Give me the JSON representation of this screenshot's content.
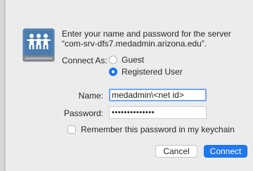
{
  "dialog": {
    "message": "Enter your name and password for the server “com-srv-dfs7.medadmin.arizona.edu”.",
    "icon": "network-server-users-icon"
  },
  "connect_as": {
    "label": "Connect As:",
    "options": [
      {
        "label": "Guest",
        "selected": false
      },
      {
        "label": "Registered User",
        "selected": true
      }
    ]
  },
  "fields": {
    "name_label": "Name:",
    "name_value": "medadmin\\<net id>",
    "password_label": "Password:",
    "password_value": "••••••••••••••"
  },
  "remember": {
    "label": "Remember this password in my keychain",
    "checked": false
  },
  "buttons": {
    "cancel": "Cancel",
    "connect": "Connect"
  },
  "colors": {
    "accent": "#1f78f0",
    "focus_ring": "#73a6f0"
  }
}
